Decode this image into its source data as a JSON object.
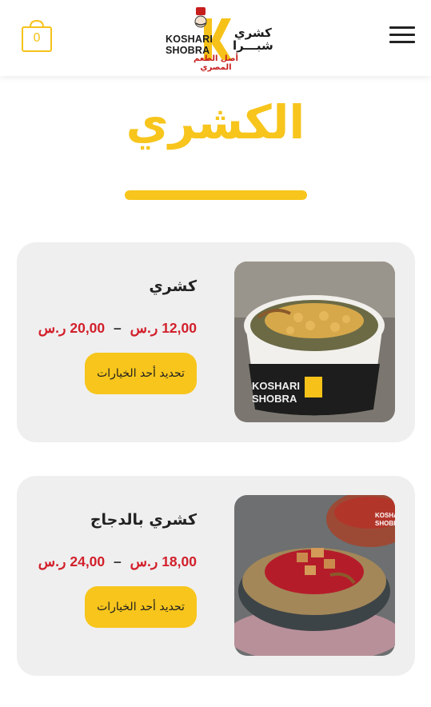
{
  "header": {
    "cart_count": "0",
    "logo": {
      "en_line1": "KOSHARI",
      "en_line2": "SHOBRA",
      "ar_line1": "كشري",
      "ar_line2": "شبـــرا",
      "tagline": "أصل الطعم المصري"
    }
  },
  "page": {
    "title": "الكشري"
  },
  "products": [
    {
      "name": "كشري",
      "price_min": "12,00",
      "price_max": "20,00",
      "currency": "ر.س",
      "dash": "–",
      "button": "تحديد أحد الخيارات",
      "image_text": "KOSHARI SHOBRA"
    },
    {
      "name": "كشري بالدجاج",
      "price_min": "18,00",
      "price_max": "24,00",
      "currency": "ر.س",
      "dash": "–",
      "button": "تحديد أحد الخيارات",
      "image_text": "KOSHARI SHOBRA"
    }
  ],
  "colors": {
    "accent": "#f7c51c",
    "price": "#d2202b",
    "card_bg": "#efefef"
  }
}
